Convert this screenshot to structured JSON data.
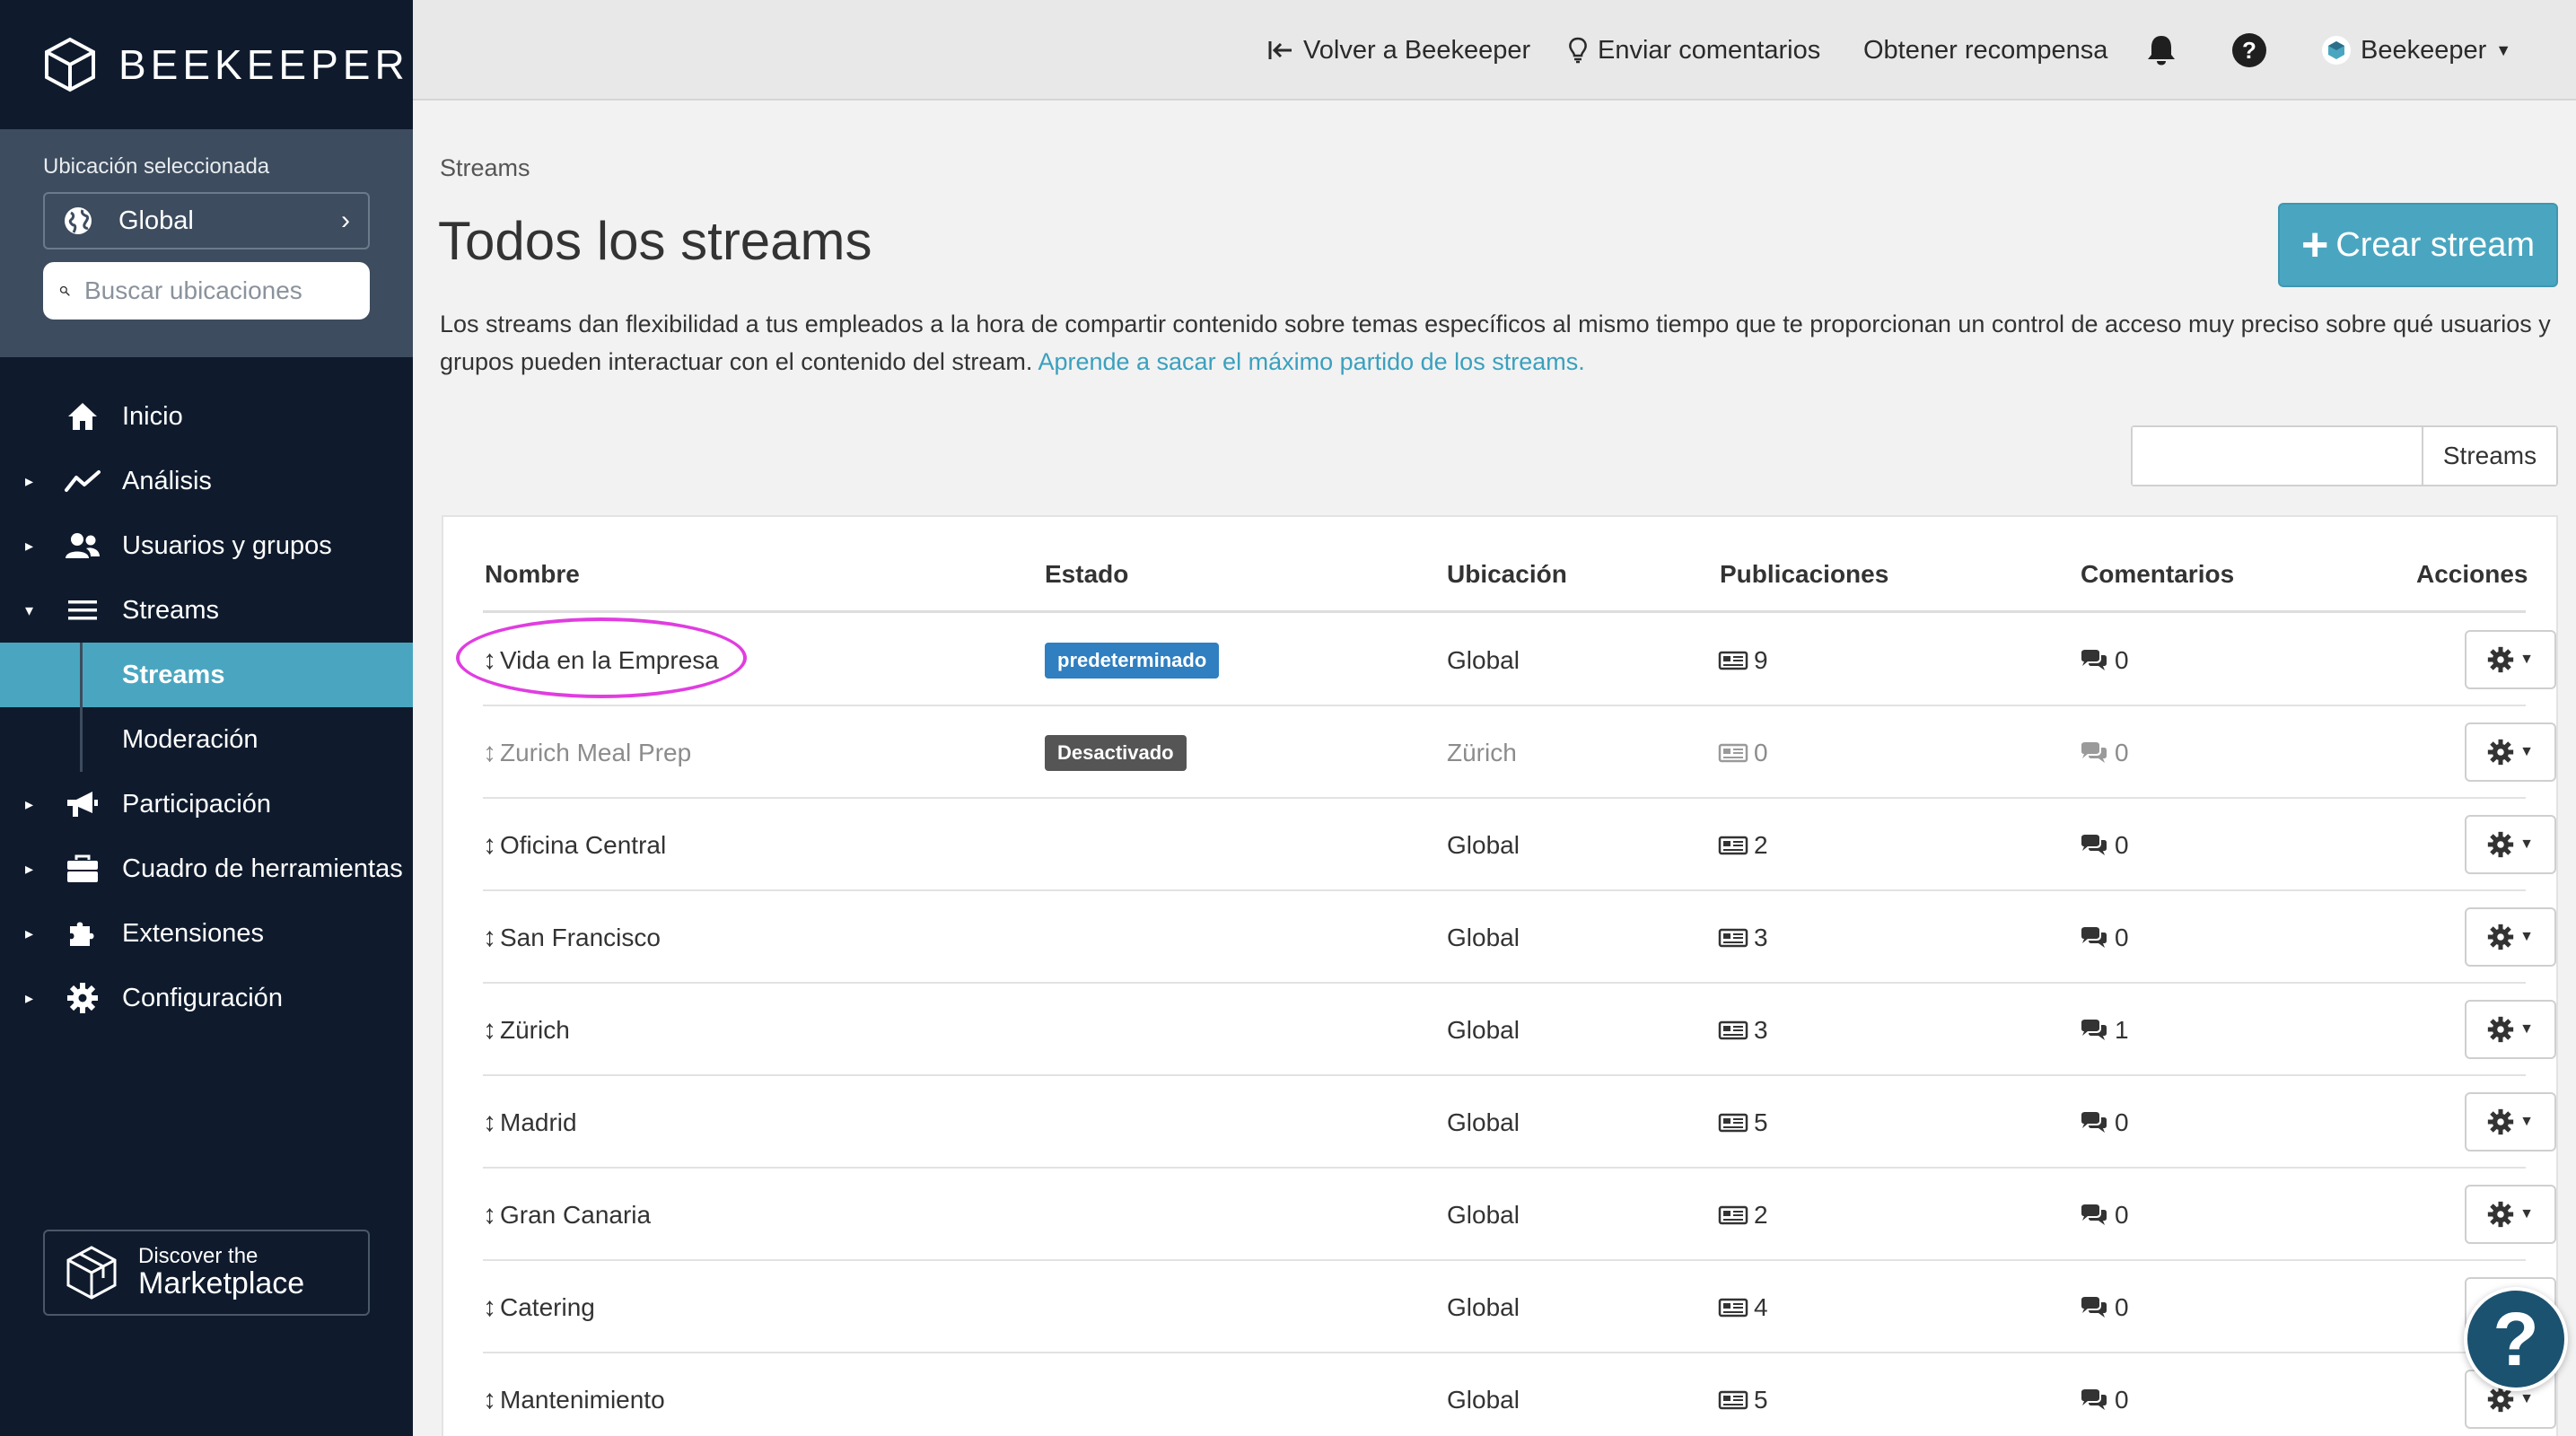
{
  "brand": {
    "name": "BEEKEEPER"
  },
  "location": {
    "label": "Ubicación seleccionada",
    "selected": "Global",
    "search_placeholder": "Buscar ubicaciones"
  },
  "nav": {
    "items": [
      {
        "label": "Inicio",
        "icon": "home-icon",
        "caret": false
      },
      {
        "label": "Análisis",
        "icon": "chart-line-icon",
        "caret": true
      },
      {
        "label": "Usuarios y grupos",
        "icon": "users-icon",
        "caret": true
      },
      {
        "label": "Streams",
        "icon": "bars-icon",
        "caret": true,
        "expanded": true
      },
      {
        "label": "Participación",
        "icon": "megaphone-icon",
        "caret": true
      },
      {
        "label": "Cuadro de herramientas",
        "icon": "toolbox-icon",
        "caret": true
      },
      {
        "label": "Extensiones",
        "icon": "puzzle-icon",
        "caret": true
      },
      {
        "label": "Configuración",
        "icon": "gear-icon",
        "caret": true
      }
    ],
    "sub_items": [
      {
        "label": "Streams",
        "active": true
      },
      {
        "label": "Moderación",
        "active": false
      }
    ]
  },
  "marketplace": {
    "line1": "Discover the",
    "line2": "Marketplace"
  },
  "topbar": {
    "back": "Volver a Beekeeper",
    "feedback": "Enviar comentarios",
    "reward": "Obtener recompensa",
    "account": "Beekeeper"
  },
  "page": {
    "breadcrumb": "Streams",
    "title": "Todos los streams",
    "create_button": "Crear stream",
    "description": "Los streams dan flexibilidad a tus empleados a la hora de compartir contenido sobre temas específicos al mismo tiempo que te proporcionan un control de acceso muy preciso sobre qué usuarios y grupos pueden interactuar con el contenido del stream.",
    "description_link": "Aprende a sacar el máximo partido de los streams.",
    "filter_value": "",
    "filter_button": "Streams"
  },
  "table": {
    "headers": [
      "Nombre",
      "Estado",
      "Ubicación",
      "Publicaciones",
      "Comentarios",
      "Acciones"
    ],
    "rows": [
      {
        "name": "Vida en la Empresa",
        "status": "predeterminado",
        "location": "Global",
        "posts": "9",
        "comments": "0"
      },
      {
        "name": "Zurich Meal Prep",
        "status": "Desactivado",
        "location": "Zürich",
        "posts": "0",
        "comments": "0"
      },
      {
        "name": "Oficina Central",
        "status": "",
        "location": "Global",
        "posts": "2",
        "comments": "0"
      },
      {
        "name": "San Francisco",
        "status": "",
        "location": "Global",
        "posts": "3",
        "comments": "0"
      },
      {
        "name": "Zürich",
        "status": "",
        "location": "Global",
        "posts": "3",
        "comments": "1"
      },
      {
        "name": "Madrid",
        "status": "",
        "location": "Global",
        "posts": "5",
        "comments": "0"
      },
      {
        "name": "Gran Canaria",
        "status": "",
        "location": "Global",
        "posts": "2",
        "comments": "0"
      },
      {
        "name": "Catering",
        "status": "",
        "location": "Global",
        "posts": "4",
        "comments": "0"
      },
      {
        "name": "Mantenimiento",
        "status": "",
        "location": "Global",
        "posts": "5",
        "comments": "0"
      }
    ]
  },
  "help": {
    "symbol": "?"
  }
}
